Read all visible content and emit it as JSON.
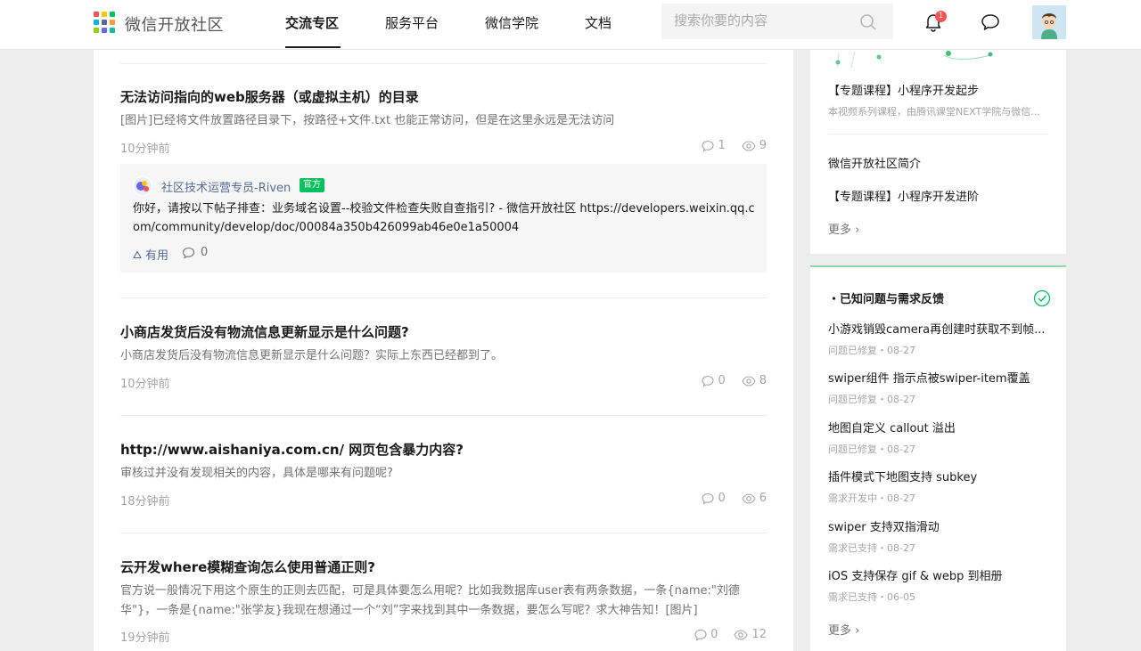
{
  "header": {
    "site_name": "微信开放社区",
    "nav": [
      "交流专区",
      "服务平台",
      "微信学院",
      "文档"
    ],
    "search_placeholder": "搜索你要的内容",
    "notification_count": "1",
    "icons": [
      "logo-icon",
      "search-icon",
      "bell-icon",
      "message-icon",
      "avatar"
    ]
  },
  "questions": [
    {
      "title": "无法访问指向的web服务器（或虚拟主机）的目录",
      "desc": "[图片]已经将文件放置路径目录下，按路径+文件.txt 也能正常访问，但是在这里永远是无法访问",
      "time": "10分钟前",
      "comments": "1",
      "views": "9",
      "answer": {
        "author": "社区技术运营专员-Riven",
        "badge": "官方",
        "text": "你好，请按以下帖子排查：业务域名设置--校验文件检查失败自查指引? - 微信开放社区 https://developers.weixin.qq.com/community/develop/doc/00084a350b426099ab46e0e1a50004",
        "useful_label": "有用",
        "comment_count": "0"
      }
    },
    {
      "title": "小商店发货后没有物流信息更新显示是什么问题?",
      "desc": "小商店发货后没有物流信息更新显示是什么问题？实际上东西已经都到了。",
      "time": "10分钟前",
      "comments": "0",
      "views": "8"
    },
    {
      "title": "http://www.aishaniya.com.cn/ 网页包含暴力内容?",
      "desc": "审核过并没有发现相关的内容，具体是哪来有问题呢?",
      "time": "18分钟前",
      "comments": "0",
      "views": "6"
    },
    {
      "title": "云开发where模糊查询怎么使用普通正则?",
      "desc": "官方说一般情况下用这个原生的正则去匹配，可是具体要怎么用呢？比如我数据库user表有两条数据，一条{name:\"刘德华\"}，一条是{name:\"张学友}我现在想通过一个“刘”字来找到其中一条数据，要怎么写呢？求大神告知！[图片]",
      "time": "19分钟前",
      "comments": "0",
      "views": "12"
    }
  ],
  "sidebar": {
    "course": {
      "title": "【专题课程】小程序开发起步",
      "sub": "本视频系列课程，由腾讯课堂NEXT学院与微信..."
    },
    "links": [
      "微信开放社区简介",
      "【专题课程】小程序开发进阶"
    ],
    "more": "更多",
    "issues_heading": "已知问题与需求反馈",
    "issues": [
      {
        "title": "小游戏销毁camera再创建时获取不到帧...",
        "status": "问题已修复・08-27"
      },
      {
        "title": "swiper组件 指示点被swiper-item覆盖",
        "status": "问题已修复・08-27"
      },
      {
        "title": "地图自定义 callout 溢出",
        "status": "问题已修复・08-27"
      },
      {
        "title": "插件模式下地图支持 subkey",
        "status": "需求开发中・08-27"
      },
      {
        "title": "swiper 支持双指滑动",
        "status": "需求已支持・08-27"
      },
      {
        "title": "iOS 支持保存 gif & webp 到相册",
        "status": "需求已支持・06-05"
      }
    ],
    "issues_more": "更多"
  }
}
